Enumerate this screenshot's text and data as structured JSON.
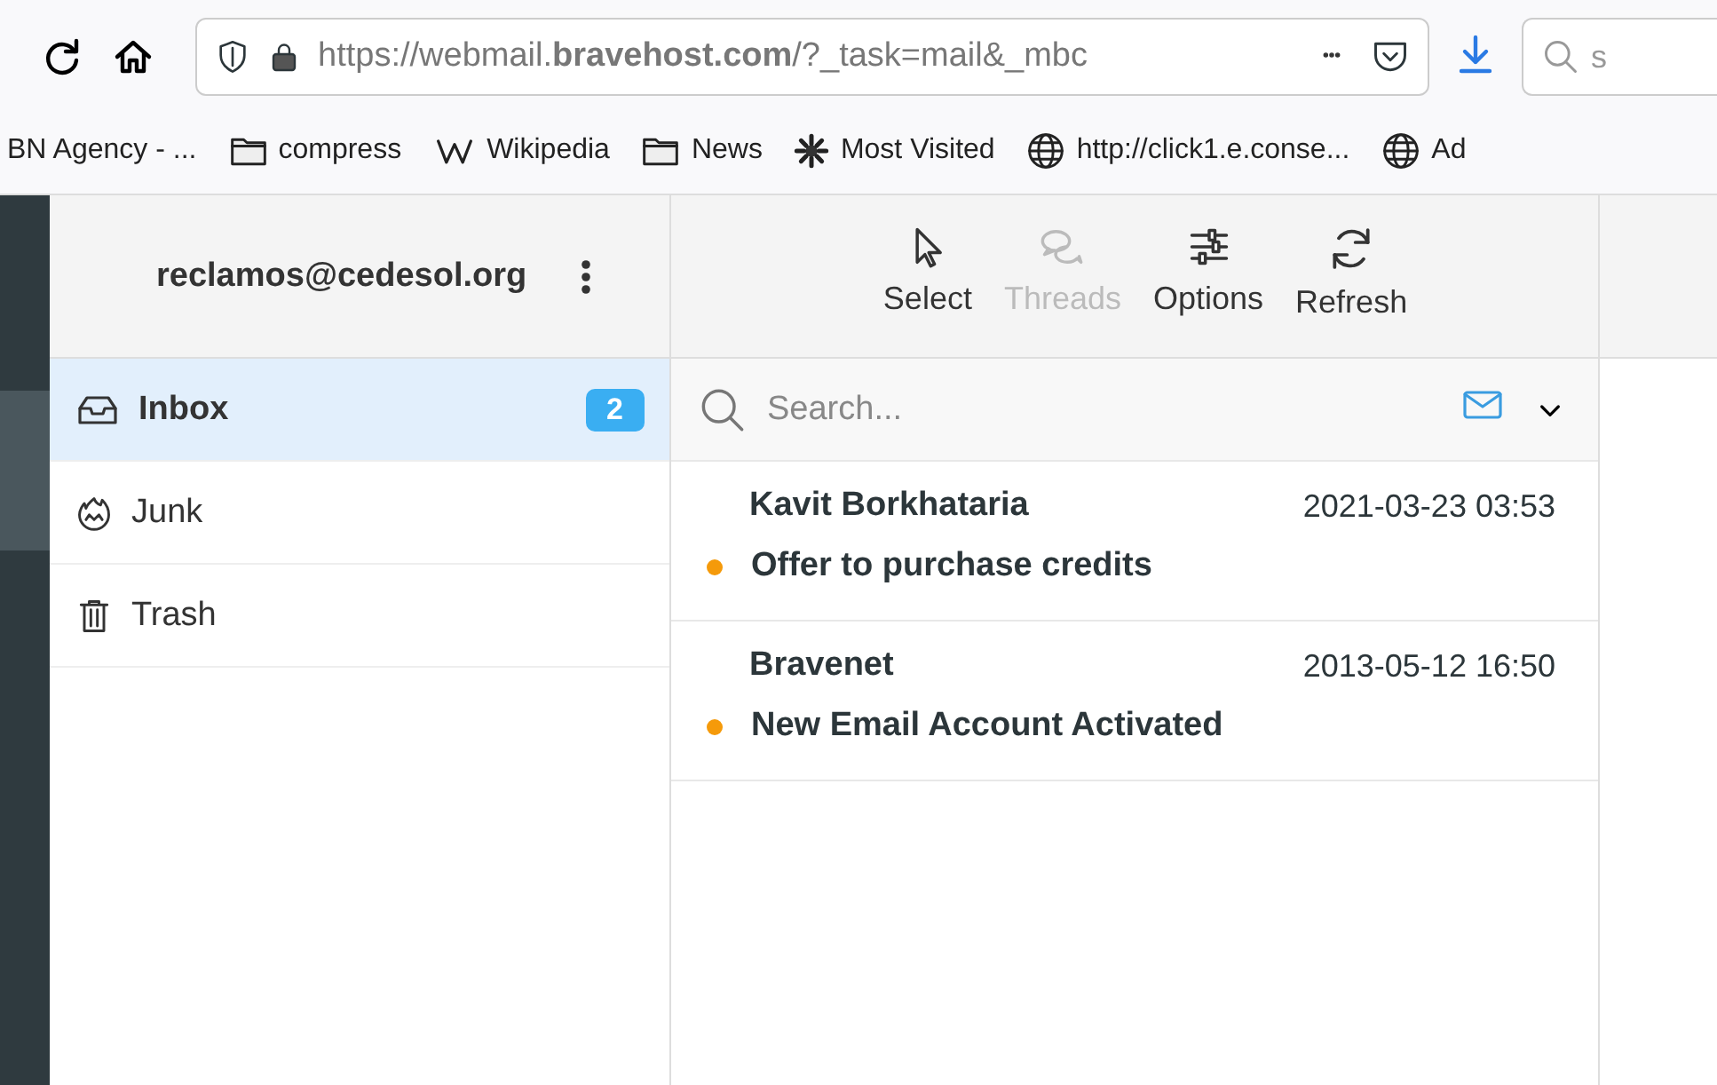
{
  "browser": {
    "url": "https://webmail.**bravehost.com**/?_task=mail&_mbc",
    "search_cut": "s",
    "bookmarks": [
      {
        "kind": "plain",
        "label": "BN Agency - ..."
      },
      {
        "kind": "folder",
        "label": "compress"
      },
      {
        "kind": "wiki",
        "label": "Wikipedia"
      },
      {
        "kind": "folder",
        "label": "News"
      },
      {
        "kind": "gear",
        "label": "Most Visited"
      },
      {
        "kind": "globe",
        "label": "http://click1.e.conse..."
      },
      {
        "kind": "globe",
        "label": "Ad"
      }
    ]
  },
  "account": "reclamos@cedesol.org",
  "folders": [
    {
      "kind": "inbox",
      "label": "Inbox",
      "selected": true,
      "count": "2"
    },
    {
      "kind": "junk",
      "label": "Junk",
      "selected": false
    },
    {
      "kind": "trash",
      "label": "Trash",
      "selected": false
    }
  ],
  "toolbar": [
    {
      "kind": "select",
      "label": "Select",
      "disabled": false
    },
    {
      "kind": "threads",
      "label": "Threads",
      "disabled": true
    },
    {
      "kind": "options",
      "label": "Options",
      "disabled": false
    },
    {
      "kind": "refresh",
      "label": "Refresh",
      "disabled": false
    }
  ],
  "search": {
    "placeholder": "Search..."
  },
  "messages": [
    {
      "sender": "Kavit Borkhataria",
      "date": "2021-03-23 03:53",
      "subject": "Offer to purchase credits",
      "unread": true
    },
    {
      "sender": "Bravenet",
      "date": "2013-05-12 16:50",
      "subject": "New Email Account Activated",
      "unread": true
    }
  ]
}
